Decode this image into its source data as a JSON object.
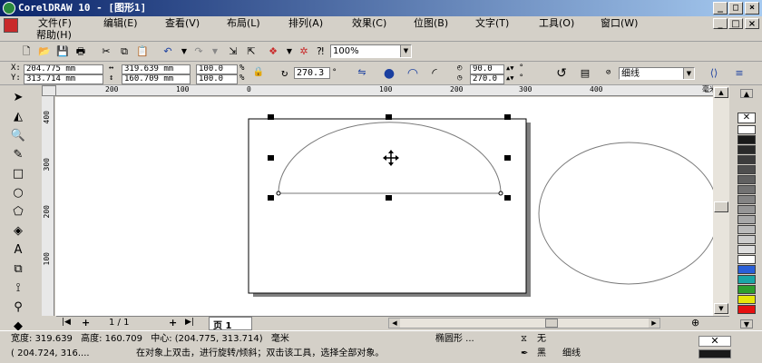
{
  "window": {
    "title": "CorelDRAW 10 - [图形1]",
    "min": "_",
    "max": "□",
    "close": "×"
  },
  "menu": {
    "row1": [
      "文件(F)",
      "编辑(E)",
      "查看(V)",
      "布局(L)",
      "排列(A)",
      "效果(C)",
      "位图(B)",
      "文字(T)",
      "工具(O)",
      "窗口(W)"
    ],
    "help": "帮助(H)",
    "doc_buttons": [
      "_",
      "□",
      "×"
    ]
  },
  "toolbar": {
    "zoom": "100%"
  },
  "property_bar": {
    "x_label": "X:",
    "x_value": "204.775 mm",
    "y_label": "Y:",
    "y_value": "313.714 mm",
    "w_value": "319.639 mm",
    "h_value": "160.709 mm",
    "scale_x": "100.0",
    "scale_y": "100.0",
    "pct": "%",
    "rotation": "270.3",
    "deg": "°",
    "start_angle": "90.0",
    "end_angle": "270.0",
    "outline": "细线"
  },
  "rulers": {
    "h_ticks": [
      "200",
      "100",
      "0",
      "100",
      "200",
      "300",
      "400"
    ],
    "h_unit": "毫米",
    "v_ticks": [
      "400",
      "300",
      "200",
      "100"
    ]
  },
  "nav": {
    "page_count": "1 / 1",
    "page_tab": "页 1"
  },
  "status": {
    "width_label": "宽度:",
    "width_value": "319.639",
    "height_label": "高度:",
    "height_value": "160.709",
    "center_label": "中心:",
    "center_value": "(204.775, 313.714)",
    "unit": "毫米",
    "object_type": "椭圆形 ...",
    "fill": "无",
    "coords": "( 204.724, 316....",
    "hint": "在对象上双击，进行旋转/倾斜；双击该工具，选择全部对象。",
    "outline_color": "黑",
    "outline_width": "细线"
  },
  "palette": {
    "colors": [
      "#ffffff",
      "#1a1a1a",
      "#2a2a2a",
      "#3c3c3c",
      "#4e4e4e",
      "#606060",
      "#727272",
      "#848484",
      "#969696",
      "#a8a8a8",
      "#bababa",
      "#cccccc",
      "#dedede",
      "#ffffff",
      "#2a5fd8",
      "#1aa6a6",
      "#2e9e2e",
      "#e6e60a",
      "#e61010"
    ]
  }
}
